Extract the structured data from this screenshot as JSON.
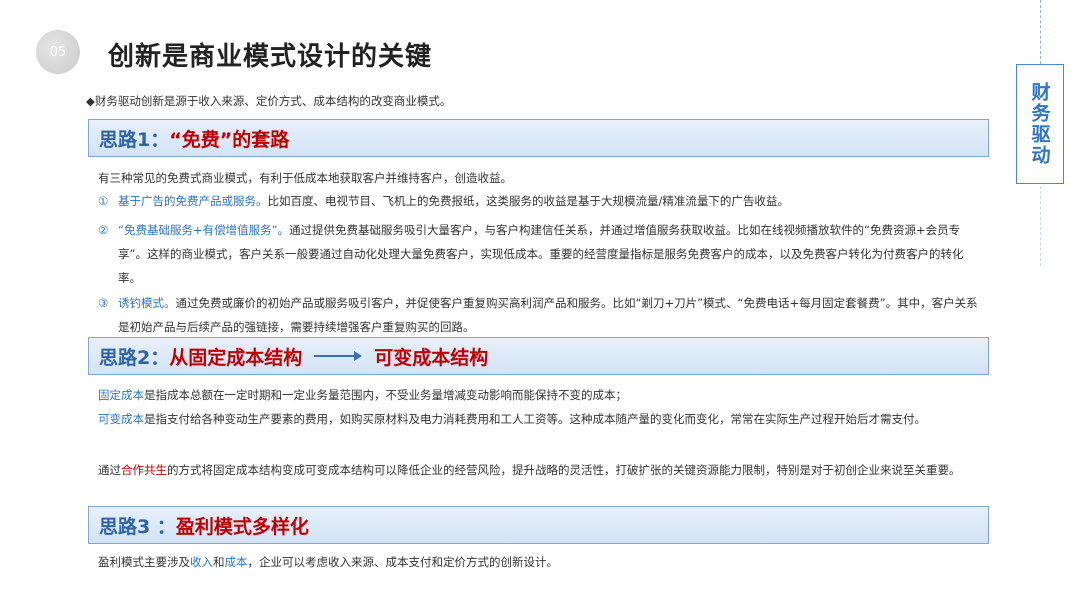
{
  "header": {
    "page_number": "05",
    "title": "创新是商业模式设计的关键"
  },
  "side_tag": "财务驱动",
  "intro": "◆财务驱动创新是源于收入来源、定价方式、成本结构的改变商业模式。",
  "section1": {
    "label": "思路1：",
    "title": "“免费”的套路",
    "lead": "有三种常见的免费式商业模式，有利于低成本地获取客户并维持客户，创造收益。",
    "items": [
      {
        "num": "①",
        "head": "基于广告的免费产品或服务。",
        "text": "比如百度、电视节目、飞机上的免费报纸，这类服务的收益是基于大规模流量/精准流量下的广告收益。"
      },
      {
        "num": "②",
        "head": "“免费基础服务+有偿增值服务”。",
        "text": "通过提供免费基础服务吸引大量客户，与客户构建信任关系，并通过增值服务获取收益。比如在线视频播放软件的“免费资源+会员专享”。这样的商业模式，客户关系一般要通过自动化处理大量免费客户，实现低成本。重要的经营度量指标是服务免费客户的成本，以及免费客户转化为付费客户的转化率。"
      },
      {
        "num": "③",
        "head": "诱钓模式。",
        "text": "通过免费或廉价的初始产品或服务吸引客户，并促使客户重复购买高利润产品和服务。比如“剃刀+刀片”模式、“免费电话+每月固定套餐费”。其中，客户关系是初始产品与后续产品的强链接，需要持续增强客户重复购买的回路。"
      }
    ]
  },
  "section2": {
    "label": "思路2：",
    "title_from": "从固定成本结构",
    "title_to": "可变成本结构",
    "fixed_term": "固定成本",
    "fixed_text": "是指成本总额在一定时期和一定业务量范围内，不受业务量增减变动影响而能保持不变的成本；",
    "variable_term": "可变成本",
    "variable_text": "是指支付给各种变动生产要素的费用，如购买原材料及电力消耗费用和工人工资等。这种成本随产量的变化而变化，常常在实际生产过程开始后才需支付。",
    "coop_prefix": "通过",
    "coop_term": "合作共生",
    "coop_text": "的方式将固定成本结构变成可变成本结构可以降低企业的经营风险，提升战略的灵活性，打破扩张的关键资源能力限制，特别是对于初创企业来说至关重要。"
  },
  "section3": {
    "label": "思路3 ：",
    "title": "盈利模式多样化",
    "t1": "盈利模式主要涉及",
    "k1": "收入",
    "t2": "和",
    "k2": "成本",
    "t3": "，企业可以考虑收入来源、成本支付和定价方式的创新设计。"
  },
  "colors": {
    "accent_blue": "#2f74c8",
    "accent_red": "#c00000",
    "bar_bg": "#dce8f6"
  }
}
